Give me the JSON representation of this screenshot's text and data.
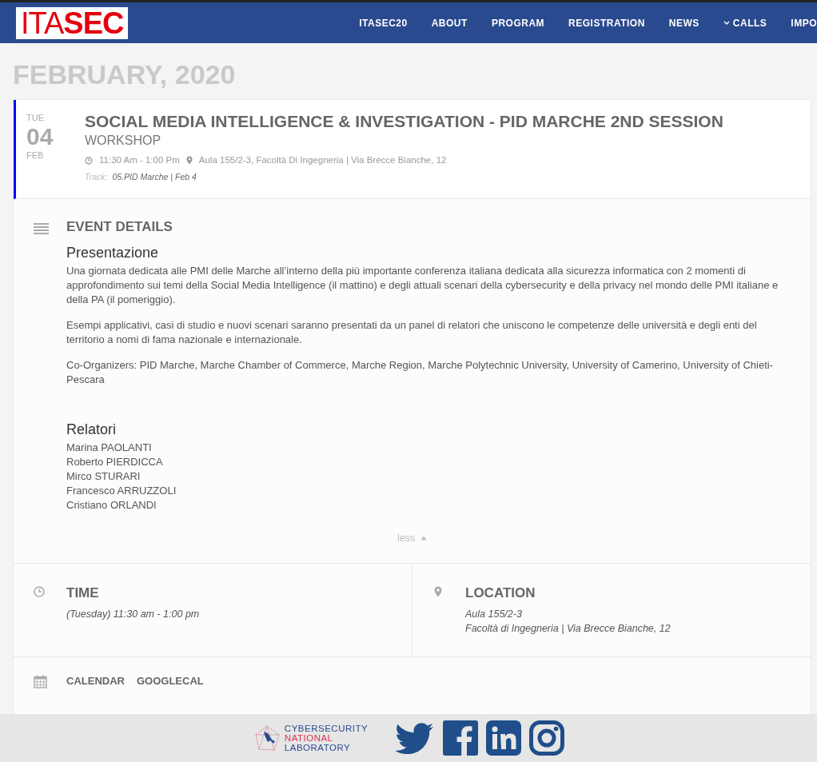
{
  "header": {
    "logo": {
      "light": "ITA",
      "bold": "SEC"
    },
    "nav": [
      {
        "label": "ITASEC20",
        "dropdown": false
      },
      {
        "label": "ABOUT",
        "dropdown": false
      },
      {
        "label": "PROGRAM",
        "dropdown": false
      },
      {
        "label": "REGISTRATION",
        "dropdown": false
      },
      {
        "label": "NEWS",
        "dropdown": false
      },
      {
        "label": "CALLS",
        "dropdown": true
      },
      {
        "label": "IMPO",
        "dropdown": false
      }
    ]
  },
  "month_heading": "FEBRUARY, 2020",
  "event": {
    "date": {
      "weekday": "TUE",
      "day": "04",
      "month": "FEB"
    },
    "title": "SOCIAL MEDIA INTELLIGENCE & INVESTIGATION - PID MARCHE 2ND SESSION",
    "type": "WORKSHOP",
    "time": "11:30 Am - 1:00 Pm",
    "location": "Aula 155/2-3, Facoltà Di Ingegneria | Via Brecce Bianche, 12",
    "track_label": "Track:",
    "track": "05.PID Marche | Feb 4",
    "details": {
      "heading": "EVENT DETAILS",
      "sections": [
        {
          "title": "Presentazione",
          "paragraphs": [
            "Una giornata dedicata alle PMI delle Marche all’interno della più importante conferenza italiana dedicata alla sicurezza informatica con 2 momenti di approfondimento sui temi della Social Media Intelligence (il mattino) e degli attuali scenari della cybersecurity e della privacy nel mondo delle PMI italiane e della PA (il pomeriggio).",
            "Esempi applicativi, casi di studio e nuovi scenari saranno presentati da un panel di relatori che uniscono le competenze delle università e degli enti del territorio a nomi di fama nazionale e internazionale.",
            "Co-Organizers: PID Marche, Marche Chamber of Commerce, Marche Region, Marche Polytechnic University, University of Camerino, University of Chieti-Pescara"
          ]
        },
        {
          "title": "Relatori",
          "lines": [
            "Marina PAOLANTI",
            "Roberto PIERDICCA",
            "Mirco STURARI",
            "Francesco ARRUZZOLI",
            "Cristiano ORLANDI"
          ]
        }
      ],
      "toggle": {
        "label": "less",
        "expanded": true
      }
    },
    "time_box": {
      "heading": "TIME",
      "lines": [
        "(Tuesday) 11:30 am - 1:00 pm"
      ]
    },
    "location_box": {
      "heading": "LOCATION",
      "lines": [
        "Aula 155/2-3",
        "Facoltà di Ingegneria | Via Brecce Bianche, 12"
      ]
    },
    "calendar_links": [
      "CALENDAR",
      "GOOGLECAL"
    ]
  },
  "footer": {
    "lab_logo": [
      "CYBERSECURITY",
      "NATIONAL",
      "LABORATORY"
    ],
    "social": [
      {
        "kind": "twitter"
      },
      {
        "kind": "facebook"
      },
      {
        "kind": "linkedin"
      },
      {
        "kind": "instagram"
      }
    ]
  }
}
